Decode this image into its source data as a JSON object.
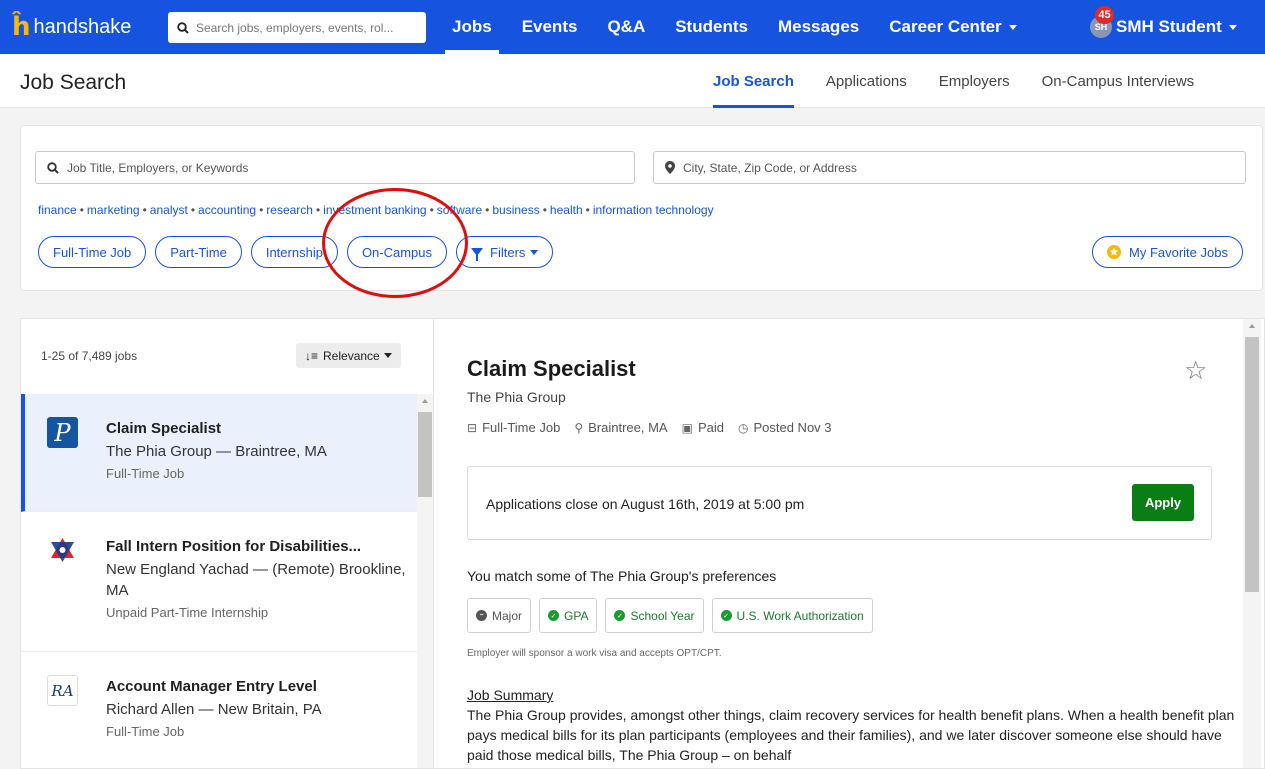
{
  "app": {
    "logo_text": "handshake",
    "search_placeholder": "Search jobs, employers, events, rol..."
  },
  "nav": {
    "items": [
      {
        "label": "Jobs"
      },
      {
        "label": "Events"
      },
      {
        "label": "Q&A"
      },
      {
        "label": "Students"
      },
      {
        "label": "Messages"
      },
      {
        "label": "Career Center"
      }
    ],
    "user": {
      "initials": "SH",
      "name": "SMH Student",
      "notifications": "45"
    }
  },
  "subheader": {
    "title": "Job Search",
    "tabs": [
      {
        "label": "Job Search"
      },
      {
        "label": "Applications"
      },
      {
        "label": "Employers"
      },
      {
        "label": "On-Campus Interviews"
      }
    ]
  },
  "filters": {
    "keyword_placeholder": "Job Title, Employers, or Keywords",
    "location_placeholder": "City, State, Zip Code, or Address",
    "suggestions": [
      "finance",
      "marketing",
      "analyst",
      "accounting",
      "research",
      "investment banking",
      "software",
      "business",
      "health",
      "information technology"
    ],
    "chips": {
      "full_time": "Full-Time Job",
      "part_time": "Part-Time",
      "internship": "Internship",
      "on_campus": "On-Campus",
      "filters": "Filters",
      "favorites": "My Favorite Jobs"
    }
  },
  "results": {
    "count": "1-25 of 7,489 jobs",
    "sort_label": "Relevance",
    "jobs": [
      {
        "title": "Claim Specialist",
        "company": "The Phia Group — Braintree, MA",
        "type": "Full-Time Job"
      },
      {
        "title": "Fall Intern Position for Disabilities...",
        "company": "New England Yachad — (Remote) Brookline, MA",
        "type": "Unpaid Part-Time Internship"
      },
      {
        "title": "Account Manager Entry Level",
        "company": "Richard Allen — New Britain, PA",
        "type": "Full-Time Job"
      }
    ]
  },
  "detail": {
    "title": "Claim Specialist",
    "company": "The Phia Group",
    "meta": {
      "type": "Full-Time Job",
      "location": "Braintree, MA",
      "pay": "Paid",
      "posted": "Posted Nov 3"
    },
    "apply_text": "Applications close on August 16th, 2019 at 5:00 pm",
    "apply_label": "Apply",
    "prefs_title": "You match some of The Phia Group's preferences",
    "prefs": [
      {
        "label": "Major",
        "match": false
      },
      {
        "label": "GPA",
        "match": true
      },
      {
        "label": "School Year",
        "match": true
      },
      {
        "label": "U.S. Work Authorization",
        "match": true
      }
    ],
    "sponsor_note": "Employer will sponsor a work visa and accepts OPT/CPT.",
    "summary_heading": "Job Summary",
    "summary_text": "The Phia Group provides, amongst other things, claim recovery services for health benefit plans. When a health benefit plan pays medical bills for its plan participants (employees and their families), and we later discover someone else should have paid those medical bills, The Phia Group – on behalf"
  },
  "colors": {
    "brand_blue": "#1654e0",
    "apply_green": "#0a7d14",
    "annotation_red": "#e00d0d"
  }
}
